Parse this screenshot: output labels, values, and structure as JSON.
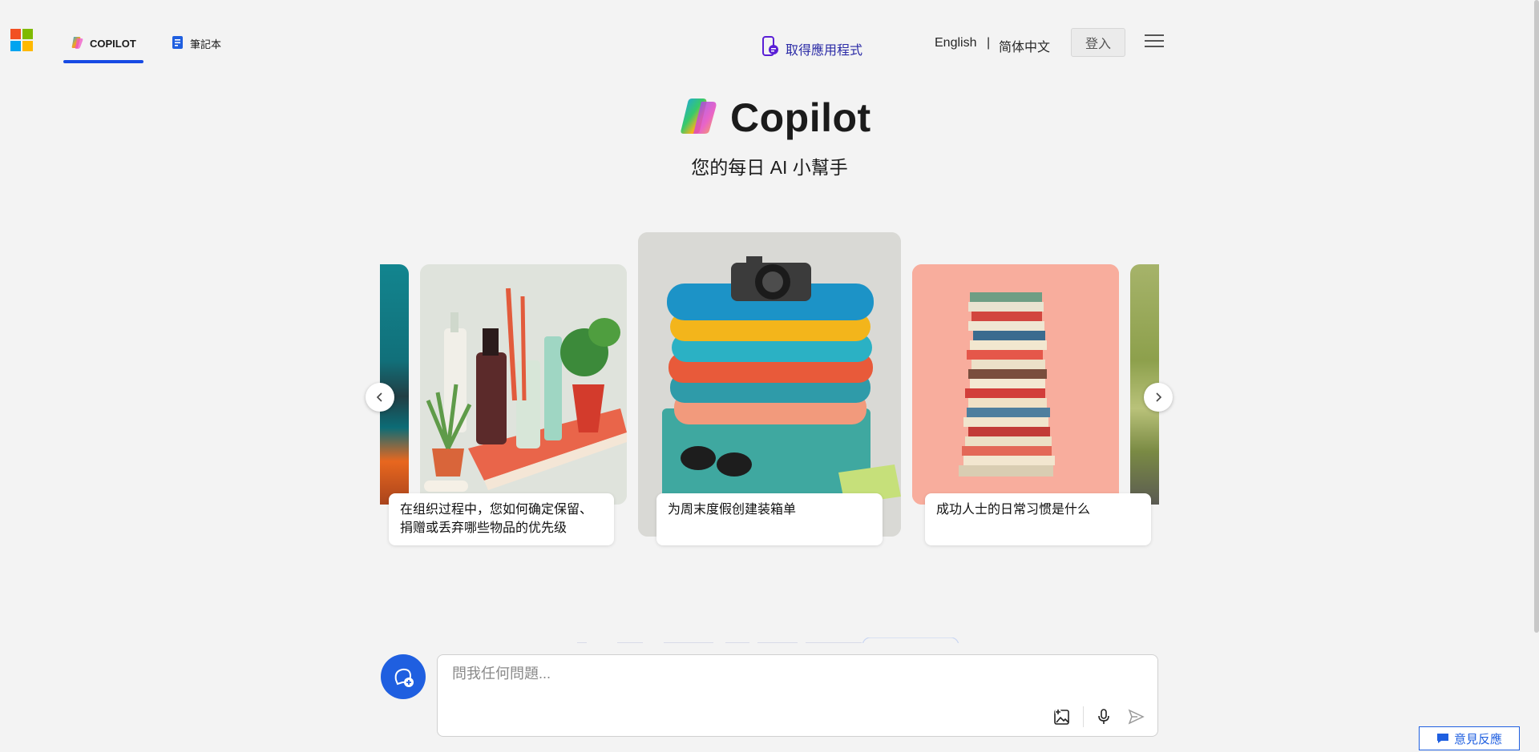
{
  "header": {
    "tabs": [
      {
        "label": "COPILOT",
        "icon": "copilot-logo-icon",
        "active": true
      },
      {
        "label": "筆記本",
        "icon": "notebook-icon",
        "active": false
      }
    ],
    "get_app": "取得應用程式",
    "languages": [
      "English",
      "简体中文"
    ],
    "lang_separator": "|",
    "sign_in": "登入",
    "accent_color": "#174ae4"
  },
  "hero": {
    "title": "Copilot",
    "subtitle": "您的每日 AI 小幫手"
  },
  "carousel": {
    "cards": [
      {
        "caption": "在组织过程中，您如何确定保留、捐赠或丢弃哪些物品的优先级",
        "image": "toiletries-plants-illustration"
      },
      {
        "caption": "为周末度假创建装箱单",
        "image": "stacked-clothes-camera-illustration"
      },
      {
        "caption": "成功人士的日常习惯是什么",
        "image": "stacked-books-illustration"
      }
    ]
  },
  "composer": {
    "placeholder": "問我任何問題..."
  },
  "feedback": "意見反應"
}
